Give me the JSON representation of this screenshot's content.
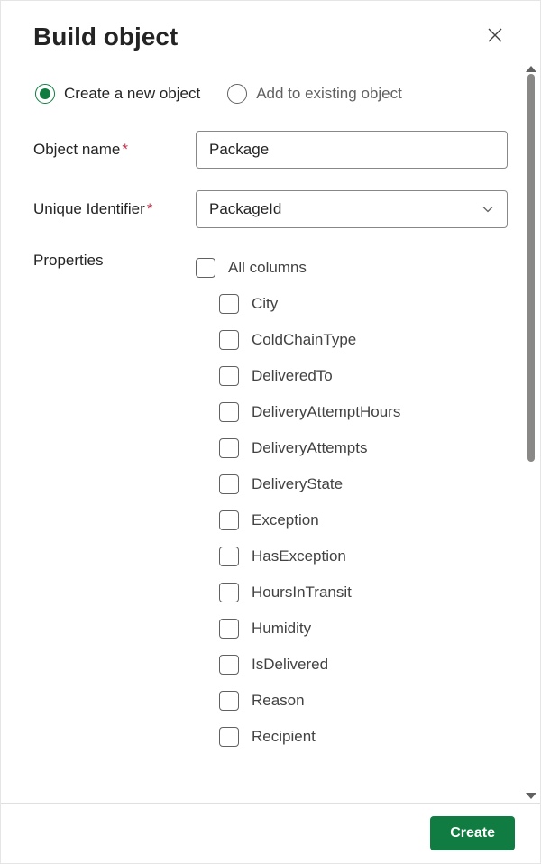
{
  "header": {
    "title": "Build object"
  },
  "mode": {
    "create_label": "Create a new object",
    "add_label": "Add to existing object",
    "selected": "create"
  },
  "fields": {
    "object_name": {
      "label": "Object name",
      "required": "*",
      "value": "Package"
    },
    "unique_id": {
      "label": "Unique Identifier",
      "required": "*",
      "value": "PackageId"
    },
    "properties_label": "Properties",
    "all_columns_label": "All columns",
    "properties": [
      {
        "label": "City"
      },
      {
        "label": "ColdChainType"
      },
      {
        "label": "DeliveredTo"
      },
      {
        "label": "DeliveryAttemptHours"
      },
      {
        "label": "DeliveryAttempts"
      },
      {
        "label": "DeliveryState"
      },
      {
        "label": "Exception"
      },
      {
        "label": "HasException"
      },
      {
        "label": "HoursInTransit"
      },
      {
        "label": "Humidity"
      },
      {
        "label": "IsDelivered"
      },
      {
        "label": "Reason"
      },
      {
        "label": "Recipient"
      }
    ]
  },
  "footer": {
    "create_label": "Create"
  }
}
